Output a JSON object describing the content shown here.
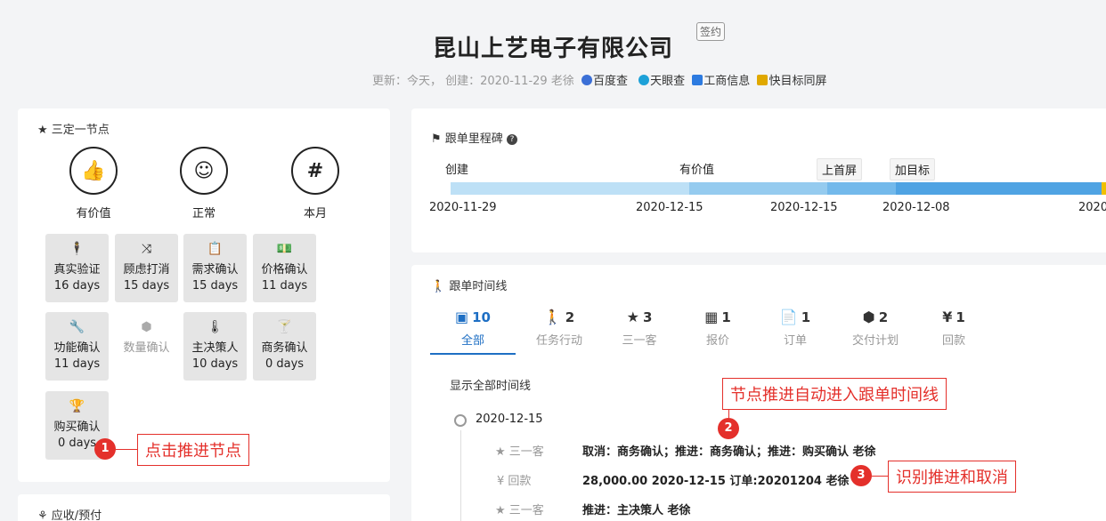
{
  "header": {
    "company": "昆山上艺电子有限公司",
    "badge": "签约",
    "meta_prefix": "更新：今天， 创建：2020-11-29 老徐",
    "links": [
      "百度查",
      "天眼查",
      "工商信息",
      "快目标同屏"
    ]
  },
  "left": {
    "title": "三定一节点",
    "big_nodes": [
      {
        "icon": "thumbs-up-icon",
        "glyph": "👍",
        "label": "有价值"
      },
      {
        "icon": "smile-icon",
        "glyph": "☺",
        "label": "正常"
      },
      {
        "icon": "hash-icon",
        "glyph": "#",
        "label": "本月"
      }
    ],
    "tiles": [
      {
        "icon": "person-icon",
        "glyph": "🕴",
        "name": "真实验证",
        "days": "16 days"
      },
      {
        "icon": "shuffle-icon",
        "glyph": "⤨",
        "name": "顾虑打消",
        "days": "15 days"
      },
      {
        "icon": "clipboard-icon",
        "glyph": "📋",
        "name": "需求确认",
        "days": "15 days"
      },
      {
        "icon": "money-icon",
        "glyph": "💵",
        "name": "价格确认",
        "days": "11 days"
      },
      {
        "icon": "wrench-icon",
        "glyph": "🔧",
        "name": "功能确认",
        "days": "11 days"
      },
      {
        "icon": "cube-icon",
        "glyph": "⬢",
        "name": "数量确认",
        "days": ""
      },
      {
        "icon": "thermometer-icon",
        "glyph": "🌡",
        "name": "主决策人",
        "days": "10 days"
      },
      {
        "icon": "glass-icon",
        "glyph": "🍸",
        "name": "商务确认",
        "days": "0 days"
      },
      {
        "icon": "trophy-icon",
        "glyph": "🏆",
        "name": "购买确认",
        "days": "0 days"
      }
    ],
    "bottom_title": "应收/预付"
  },
  "milestone": {
    "title": "跟单里程碑",
    "labels": [
      "创建",
      "有价值",
      "上首屏",
      "加目标"
    ],
    "dates": [
      "2020-11-29",
      "2020-12-15",
      "2020-12-15",
      "2020-12-08",
      "2020"
    ]
  },
  "timeline": {
    "title": "跟单时间线",
    "tabs": [
      {
        "icon": "all-icon",
        "glyph": "▣",
        "count": "10",
        "name": "全部"
      },
      {
        "icon": "walk-icon",
        "glyph": "🚶",
        "count": "2",
        "name": "任务行动"
      },
      {
        "icon": "star-icon",
        "glyph": "★",
        "count": "3",
        "name": "三一客"
      },
      {
        "icon": "calculator-icon",
        "glyph": "▦",
        "count": "1",
        "name": "报价"
      },
      {
        "icon": "document-icon",
        "glyph": "📄",
        "count": "1",
        "name": "订单"
      },
      {
        "icon": "cubes-icon",
        "glyph": "⬢",
        "count": "2",
        "name": "交付计划"
      },
      {
        "icon": "yen-icon",
        "glyph": "¥",
        "count": "1",
        "name": "回款"
      }
    ],
    "show_all": "显示全部时间线",
    "date": "2020-12-15",
    "entries": [
      {
        "icon": "★",
        "tag": "三一客",
        "text": "取消：商务确认；推进：商务确认；推进：购买确认 老徐"
      },
      {
        "icon": "¥",
        "tag": "回款",
        "text": "28,000.00 2020-12-15 订单:20201204 老徐"
      },
      {
        "icon": "★",
        "tag": "三一客",
        "text": "推进：主决策人 老徐"
      }
    ]
  },
  "annotations": [
    {
      "num": "1",
      "text": "点击推进节点"
    },
    {
      "num": "2",
      "text": "节点推进自动进入跟单时间线"
    },
    {
      "num": "3",
      "text": "识别推进和取消"
    }
  ]
}
